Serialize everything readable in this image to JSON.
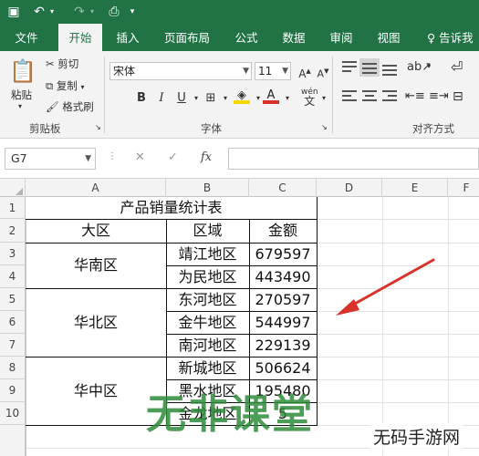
{
  "tabs": [
    "文件",
    "开始",
    "插入",
    "页面布局",
    "公式",
    "数据",
    "审阅",
    "视图"
  ],
  "tell_me": "告诉我",
  "clipboard": {
    "paste": "粘贴",
    "cut": "剪切",
    "copy": "复制",
    "format_painter": "格式刷",
    "group": "剪贴板"
  },
  "font": {
    "name": "宋体",
    "size": "11",
    "bold": "B",
    "italic": "I",
    "underline": "U",
    "wen": "wén",
    "group": "字体"
  },
  "alignment": {
    "group": "对齐方式"
  },
  "formula_bar": {
    "name_box": "G7",
    "fx": "fx",
    "cancel": "✕",
    "enter": "✓"
  },
  "columns": [
    "A",
    "B",
    "C",
    "D",
    "E",
    "F"
  ],
  "rows": [
    "1",
    "2",
    "3",
    "4",
    "5",
    "6",
    "7",
    "8",
    "9",
    "10"
  ],
  "table": {
    "title": "产品销量统计表",
    "headers": [
      "大区",
      "区域",
      "金额"
    ],
    "regions": [
      "华南区",
      "华北区",
      "华中区"
    ],
    "rows": [
      [
        "靖江地区",
        "679597"
      ],
      [
        "为民地区",
        "443490"
      ],
      [
        "东河地区",
        "270597"
      ],
      [
        "金牛地区",
        "544997"
      ],
      [
        "南河地区",
        "229139"
      ],
      [
        "新城地区",
        "506624"
      ],
      [
        "黑水地区",
        "195480"
      ],
      [
        "金龙地区",
        "5"
      ]
    ]
  },
  "watermark": "无非课堂",
  "site_mark": "无码手游网",
  "colors": {
    "brand": "#217346",
    "arrow": "#d9322a",
    "watermark": "#2e8b3a"
  }
}
